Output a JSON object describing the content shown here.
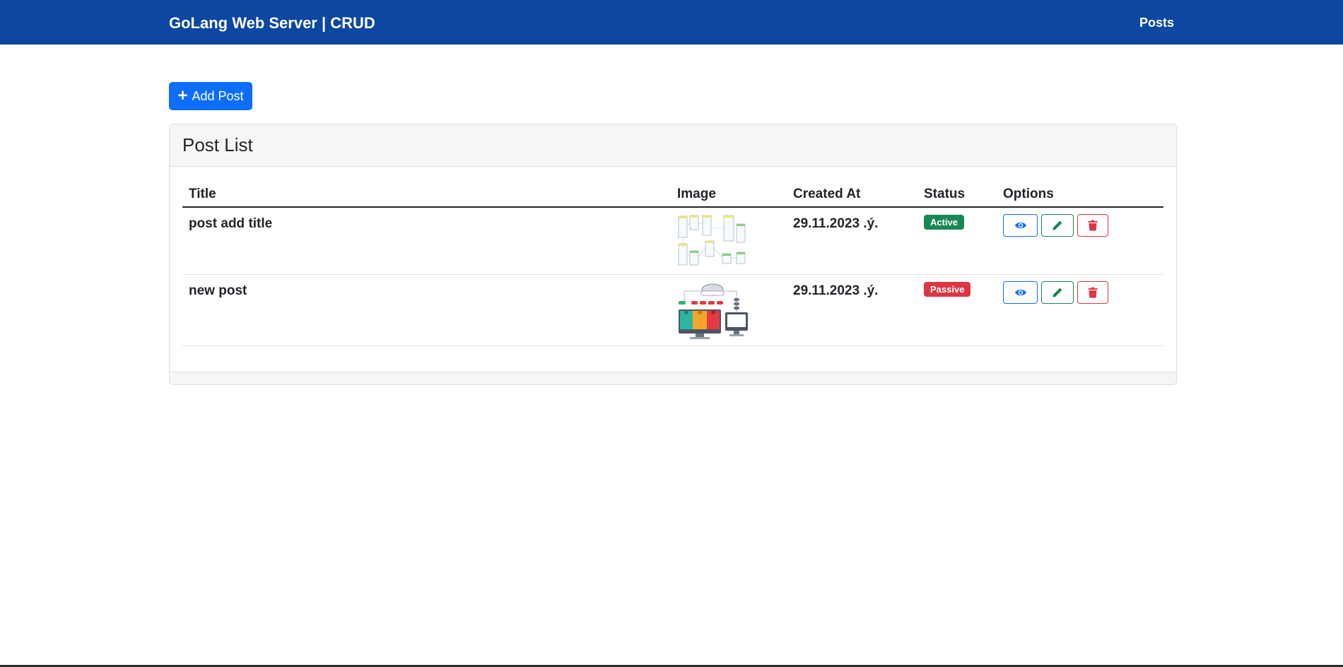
{
  "navbar": {
    "brand": "GoLang Web Server | CRUD",
    "links": [
      "Posts"
    ]
  },
  "toolbar": {
    "add_label": "Add Post"
  },
  "card": {
    "title": "Post List"
  },
  "table": {
    "headers": [
      "Title",
      "Image",
      "Created At",
      "Status",
      "Options"
    ],
    "rows": [
      {
        "title": "post add title",
        "image": "diagram-thumbnail",
        "created_at": "29.11.2023 .ý.",
        "status": "Active"
      },
      {
        "title": "new post",
        "image": "network-illustration-thumbnail",
        "created_at": "29.11.2023 .ý.",
        "status": "Passive"
      }
    ]
  },
  "colors": {
    "navbar": "#0d47a1",
    "primary": "#0d6efd",
    "success": "#198754",
    "danger": "#dc3545"
  },
  "icons": {
    "view": "eye-icon",
    "edit": "pencil-icon",
    "delete": "trash-icon",
    "add": "plus-icon"
  }
}
